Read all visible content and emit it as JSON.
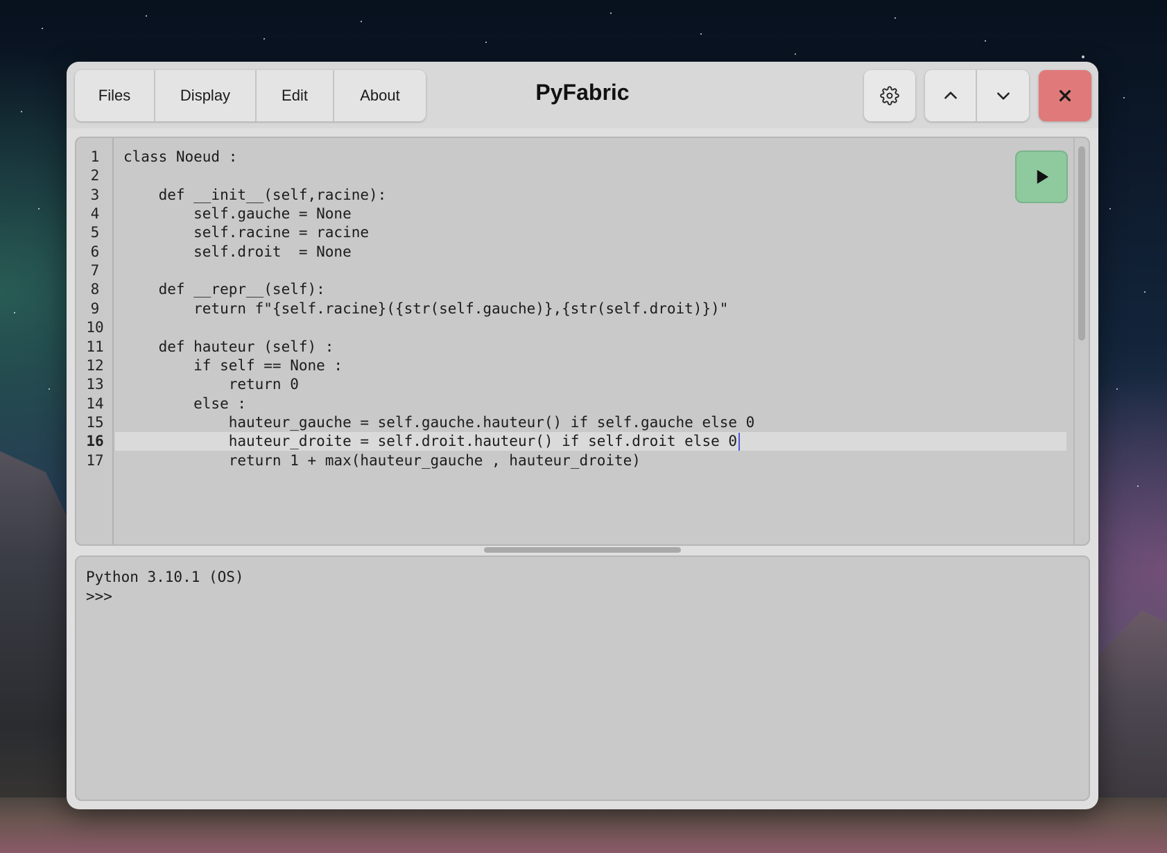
{
  "window": {
    "title": "PyFabric"
  },
  "menu": [
    {
      "label": "Files"
    },
    {
      "label": "Display"
    },
    {
      "label": "Edit"
    },
    {
      "label": "About"
    }
  ],
  "toolbar": {
    "settings_icon": "gear-icon",
    "up_icon": "chevron-up-icon",
    "down_icon": "chevron-down-icon",
    "close_icon": "close-icon",
    "run_icon": "play-icon"
  },
  "editor": {
    "current_line": 16,
    "line_numbers": [
      "1",
      "2",
      "3",
      "4",
      "5",
      "6",
      "7",
      "8",
      "9",
      "10",
      "11",
      "12",
      "13",
      "14",
      "15",
      "16",
      "17"
    ],
    "lines": [
      "class Noeud :",
      "",
      "    def __init__(self,racine):",
      "        self.gauche = None",
      "        self.racine = racine",
      "        self.droit  = None",
      "",
      "    def __repr__(self):",
      "        return f\"{self.racine}({str(self.gauche)},{str(self.droit)})\"",
      "",
      "    def hauteur (self) :",
      "        if self == None :",
      "            return 0",
      "        else :",
      "            hauteur_gauche = self.gauche.hauteur() if self.gauche else 0",
      "            hauteur_droite = self.droit.hauteur() if self.droit else 0",
      "            return 1 + max(hauteur_gauche , hauteur_droite)"
    ]
  },
  "console": {
    "lines": [
      "Python 3.10.1 (OS)",
      ">>>"
    ]
  },
  "colors": {
    "close_button": "#e07a7a",
    "run_button": "#8fc99e",
    "cursor": "#4a5ad6"
  }
}
